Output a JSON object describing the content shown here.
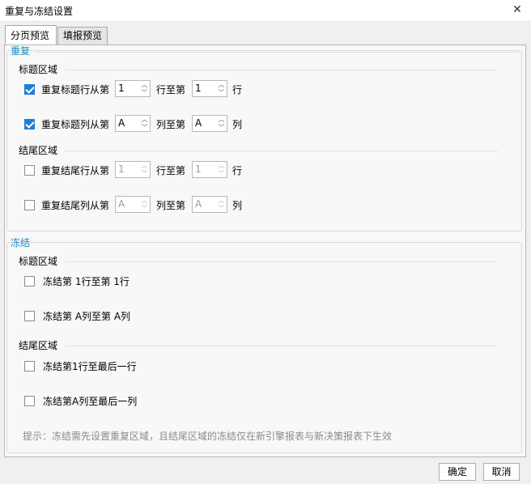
{
  "window": {
    "title": "重复与冻结设置"
  },
  "tabs": [
    {
      "label": "分页预览"
    },
    {
      "label": "填报预览"
    }
  ],
  "repeat": {
    "title": "重复",
    "header_area": "标题区域",
    "footer_area": "结尾区域",
    "rows": [
      {
        "label": "重复标题行从第",
        "checked": true,
        "from": "1",
        "mid": "行至第",
        "to": "1",
        "end": "行"
      },
      {
        "label": "重复标题列从第",
        "checked": true,
        "from": "A",
        "mid": "列至第",
        "to": "A",
        "end": "列"
      },
      {
        "label": "重复结尾行从第",
        "checked": false,
        "from": "1",
        "mid": "行至第",
        "to": "1",
        "end": "行"
      },
      {
        "label": "重复结尾列从第",
        "checked": false,
        "from": "A",
        "mid": "列至第",
        "to": "A",
        "end": "列"
      }
    ]
  },
  "freeze": {
    "title": "冻结",
    "header_area": "标题区域",
    "footer_area": "结尾区域",
    "rows": [
      {
        "label": "冻结第 1行至第 1行",
        "checked": false
      },
      {
        "label": "冻结第 A列至第 A列",
        "checked": false
      },
      {
        "label": "冻结第1行至最后一行",
        "checked": false
      },
      {
        "label": "冻结第A列至最后一列",
        "checked": false
      }
    ]
  },
  "hint": "提示：冻结需先设置重复区域，且结尾区域的冻结仅在新引擎报表与新决策报表下生效",
  "buttons": {
    "ok": "确定",
    "cancel": "取消"
  }
}
